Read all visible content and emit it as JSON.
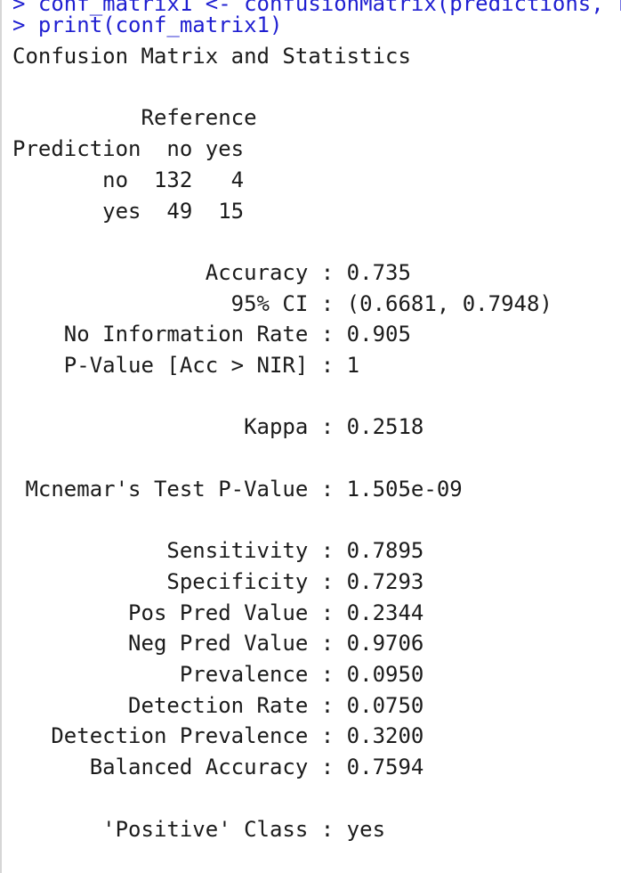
{
  "console": {
    "command_lines": [
      "> conf_matrix1 <- confusionMatrix(predictions, r",
      "> print(conf_matrix1)"
    ],
    "output_lines": [
      "Confusion Matrix and Statistics",
      "",
      "          Reference",
      "Prediction  no yes",
      "       no  132   4",
      "       yes  49  15",
      "",
      "               Accuracy : 0.735",
      "                 95% CI : (0.6681, 0.7948)",
      "    No Information Rate : 0.905",
      "    P-Value [Acc > NIR] : 1",
      "",
      "                  Kappa : 0.2518",
      "",
      " Mcnemar's Test P-Value : 1.505e-09",
      "",
      "            Sensitivity : 0.7895",
      "            Specificity : 0.7293",
      "         Pos Pred Value : 0.2344",
      "         Neg Pred Value : 0.9706",
      "             Prevalence : 0.0950",
      "         Detection Rate : 0.0750",
      "   Detection Prevalence : 0.3200",
      "      Balanced Accuracy : 0.7594",
      "",
      "       'Positive' Class : yes"
    ]
  },
  "colors": {
    "command": "#1f1fd1",
    "output": "#1b1b1b",
    "background": "#ffffff"
  }
}
